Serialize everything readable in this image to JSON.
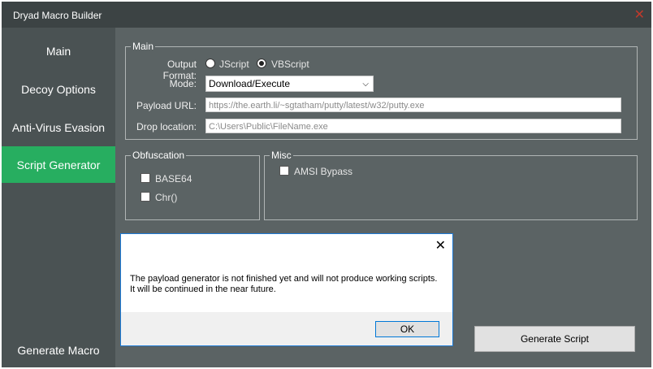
{
  "window": {
    "title": "Dryad Macro Builder"
  },
  "sidebar": {
    "items": [
      {
        "label": "Main"
      },
      {
        "label": "Decoy Options"
      },
      {
        "label": "Anti-Virus Evasion"
      },
      {
        "label": "Script Generator"
      }
    ],
    "active_index": 3,
    "generate_macro_label": "Generate Macro"
  },
  "main_group": {
    "legend": "Main",
    "output_format_label": "Output Format:",
    "formats": [
      {
        "label": "JScript",
        "selected": false
      },
      {
        "label": "VBScript",
        "selected": true
      }
    ],
    "mode_label": "Mode:",
    "mode_value": "Download/Execute",
    "payload_url_label": "Payload URL:",
    "payload_url_placeholder": "https://the.earth.li/~sgtatham/putty/latest/w32/putty.exe",
    "drop_location_label": "Drop location:",
    "drop_location_placeholder": "C:\\Users\\Public\\FileName.exe"
  },
  "obfuscation": {
    "legend": "Obfuscation",
    "options": [
      {
        "label": "BASE64",
        "checked": false
      },
      {
        "label": "Chr()",
        "checked": false
      }
    ]
  },
  "misc": {
    "legend": "Misc",
    "options": [
      {
        "label": "AMSI Bypass",
        "checked": false
      }
    ]
  },
  "generate_script_label": "Generate Script",
  "dialog": {
    "message": "The payload generator is not finished yet and will not produce working scripts. It will be continued in the near future.",
    "ok_label": "OK"
  }
}
